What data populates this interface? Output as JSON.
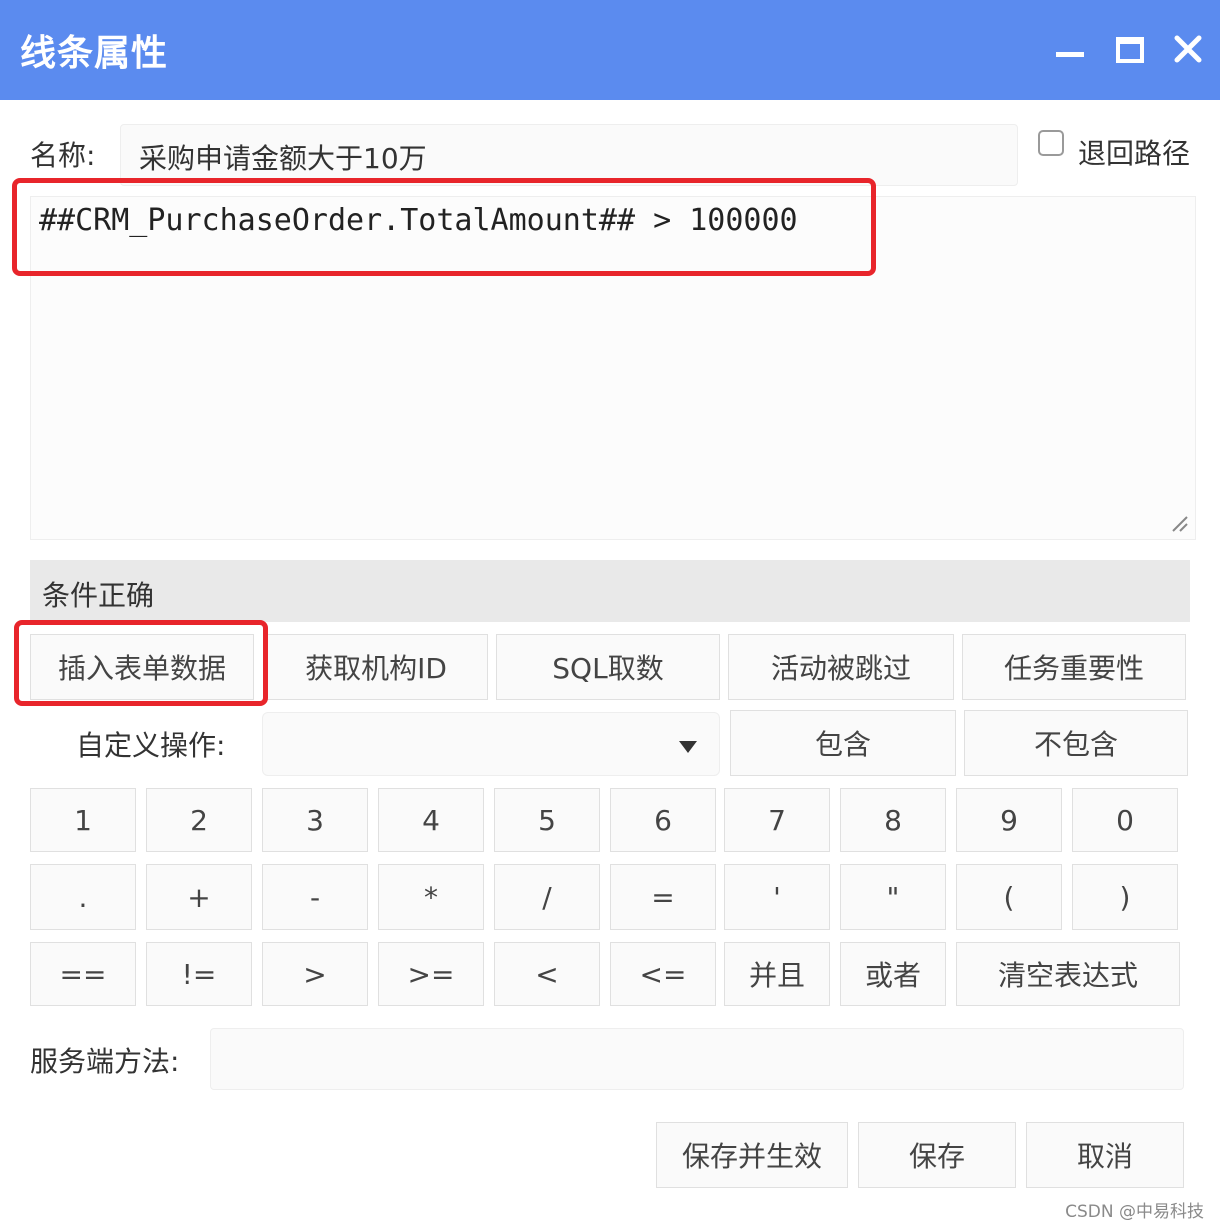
{
  "window": {
    "title": "线条属性",
    "minimize_icon": "minimize-icon",
    "maximize_icon": "maximize-icon",
    "close_icon": "close-icon",
    "titlebar_color": "#5b8bef"
  },
  "form": {
    "name_label": "名称:",
    "name_value": "采购申请金额大于10万",
    "return_path_label": "退回路径",
    "return_path_checked": false,
    "expression": "##CRM_PurchaseOrder.TotalAmount## > 100000",
    "status": "条件正确",
    "custom_op_label": "自定义操作:",
    "custom_op_value": "",
    "server_method_label": "服务端方法:",
    "server_method_value": ""
  },
  "function_buttons": [
    "插入表单数据",
    "获取机构ID",
    "SQL取数",
    "活动被跳过",
    "任务重要性"
  ],
  "contain_buttons": [
    "包含",
    "不包含"
  ],
  "keypad": {
    "digits": [
      "1",
      "2",
      "3",
      "4",
      "5",
      "6",
      "7",
      "8",
      "9",
      "0"
    ],
    "symbols": [
      ".",
      "+",
      "-",
      "*",
      "/",
      "=",
      "'",
      "\"",
      "(",
      ")"
    ],
    "operators": [
      "==",
      "!=",
      ">",
      ">=",
      "<",
      "<=",
      "并且",
      "或者"
    ],
    "clear": "清空表达式"
  },
  "footer": {
    "save_apply": "保存并生效",
    "save": "保存",
    "cancel": "取消"
  },
  "watermark": "CSDN @中易科技",
  "highlight_color": "#e8252b"
}
